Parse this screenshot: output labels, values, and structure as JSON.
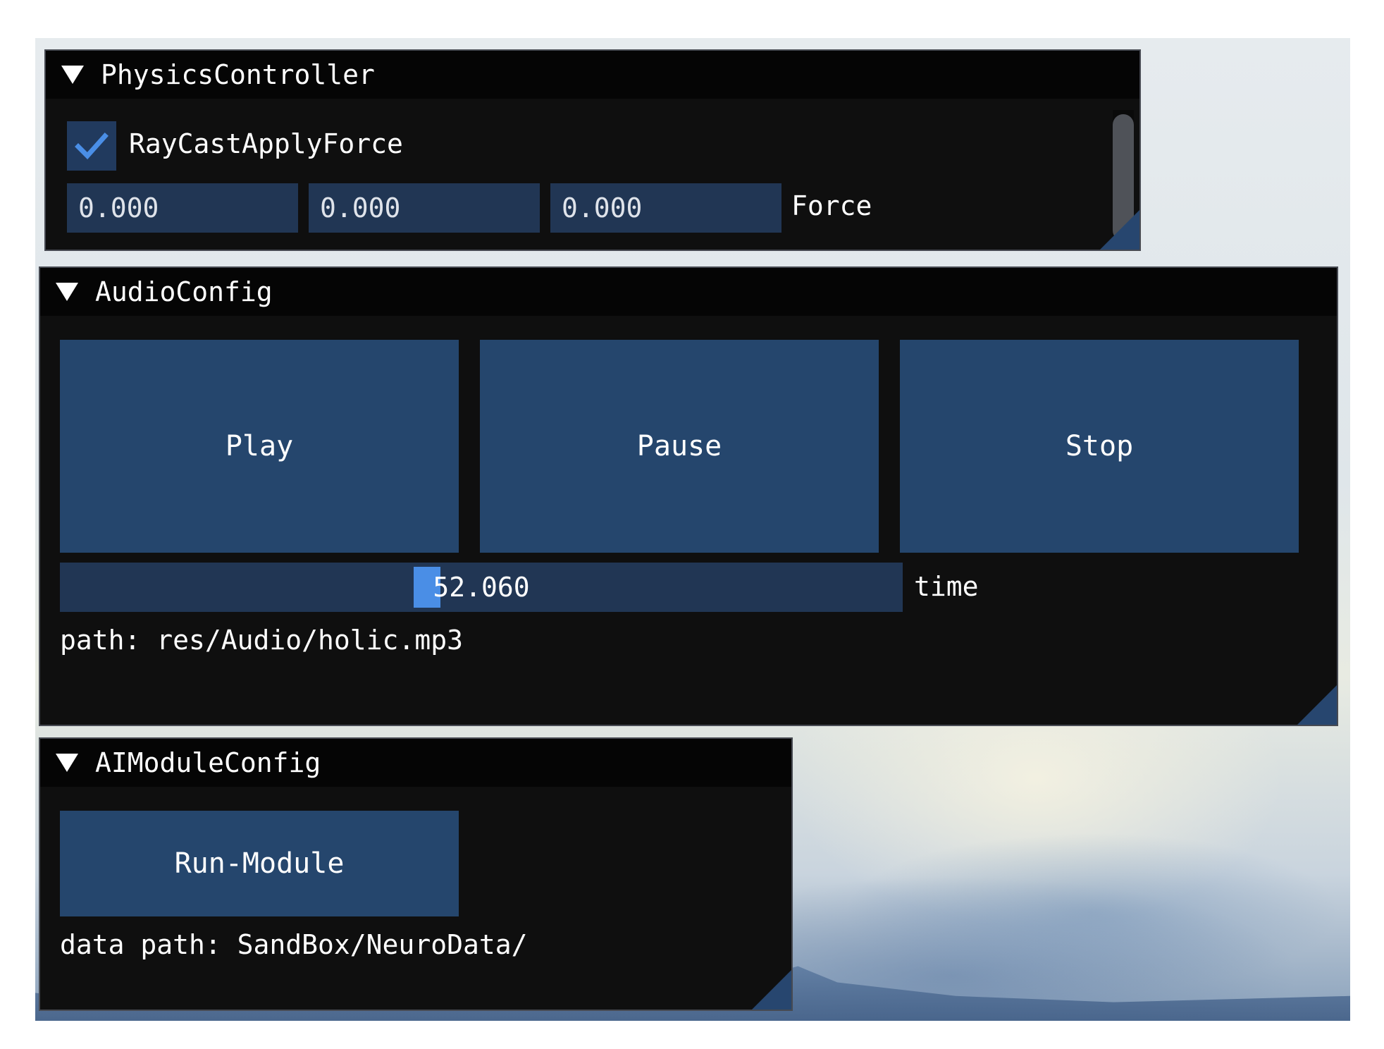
{
  "physics": {
    "title": "PhysicsController",
    "checkbox_label": "RayCastApplyForce",
    "checked": true,
    "force_values": [
      "0.000",
      "0.000",
      "0.000"
    ],
    "force_label": "Force"
  },
  "audio": {
    "title": "AudioConfig",
    "play_label": "Play",
    "pause_label": "Pause",
    "stop_label": "Stop",
    "time_value": "52.060",
    "time_label": "time",
    "path_text": "path: res/Audio/holic.mp3"
  },
  "ai": {
    "title": "AIModuleConfig",
    "run_label": "Run-Module",
    "data_path_text": "data path: SandBox/NeuroData/"
  },
  "colors": {
    "window_bg": "#0f0f0f",
    "title_bg": "#050505",
    "button": "#25466d",
    "frame": "#213654",
    "accent": "#4a8ee6"
  }
}
